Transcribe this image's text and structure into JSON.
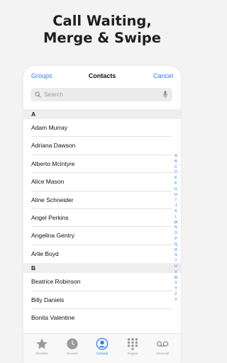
{
  "headline": {
    "line1": "Call Waiting,",
    "line2": "Merge & Swipe"
  },
  "navbar": {
    "left": "Groups",
    "title": "Contacts",
    "right": "Cancel"
  },
  "search": {
    "placeholder": "Search"
  },
  "sections": [
    {
      "letter": "A",
      "contacts": [
        "Adam Murray",
        "Adriana Dawson",
        "Alberto Mcintyre",
        "Alice Mason",
        "Aline Schneider",
        "Angel Perkins",
        "Angelina Gentry",
        "Arlie Boyd"
      ]
    },
    {
      "letter": "B",
      "contacts": [
        "Beatrice Robinson",
        "Billy Daniels",
        "Bonita Valentine"
      ]
    }
  ],
  "index": [
    "A",
    "B",
    "C",
    "D",
    "E",
    "F",
    "G",
    "H",
    "I",
    "J",
    "K",
    "L",
    "M",
    "N",
    "O",
    "P",
    "Q",
    "R",
    "S",
    "T",
    "U",
    "V",
    "W",
    "X",
    "Y",
    "Z",
    "#"
  ],
  "tabs": [
    {
      "label": "Favorites",
      "icon": "star-icon"
    },
    {
      "label": "Recents",
      "icon": "clock-icon"
    },
    {
      "label": "Contacts",
      "icon": "person-icon",
      "active": true
    },
    {
      "label": "Keypad",
      "icon": "keypad-icon"
    },
    {
      "label": "Voicemail",
      "icon": "voicemail-icon"
    }
  ],
  "colors": {
    "accent": "#2f7cf6",
    "inactive": "#9a9a9a",
    "background": "#f3f3f3"
  }
}
